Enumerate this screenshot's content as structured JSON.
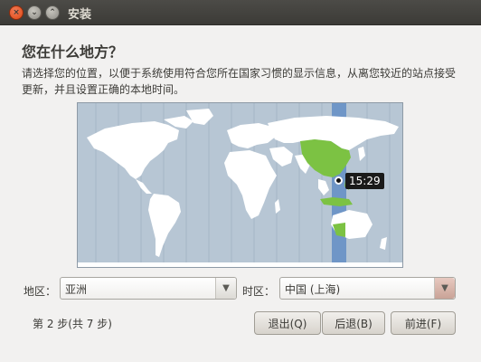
{
  "window": {
    "title": "安装",
    "close_glyph": "×",
    "min_glyph": "⌄",
    "max_glyph": "⌃"
  },
  "page": {
    "heading": "您在什么地方？",
    "description": "请选择您的位置，以便于系统使用符合您所在国家习惯的显示信息，从离您较近的站点接受更新，并且设置正确的本地时间。"
  },
  "map": {
    "selected_time": "15:29",
    "selected_region_color": "#7cc243",
    "ocean_color": "#b7c6d4",
    "land_color": "#ffffff",
    "timezone_band_color": "#6f96c7"
  },
  "region": {
    "label": "地区：",
    "value": "亚洲"
  },
  "timezone": {
    "label": "时区：",
    "value": "中国 (上海)"
  },
  "footer": {
    "steps": "第 2 步(共 7 步)",
    "quit": "退出(Q)",
    "back": "后退(B)",
    "forward": "前进(F)"
  }
}
